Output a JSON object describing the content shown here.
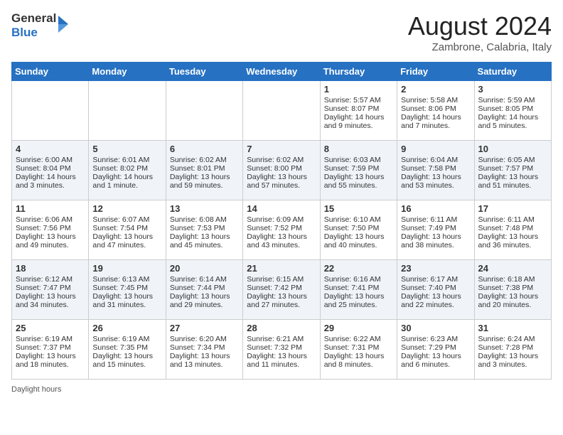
{
  "header": {
    "logo_line1": "General",
    "logo_line2": "Blue",
    "month_year": "August 2024",
    "location": "Zambrone, Calabria, Italy"
  },
  "days_of_week": [
    "Sunday",
    "Monday",
    "Tuesday",
    "Wednesday",
    "Thursday",
    "Friday",
    "Saturday"
  ],
  "weeks": [
    [
      {
        "day": "",
        "info": ""
      },
      {
        "day": "",
        "info": ""
      },
      {
        "day": "",
        "info": ""
      },
      {
        "day": "",
        "info": ""
      },
      {
        "day": "1",
        "info": "Sunrise: 5:57 AM\nSunset: 8:07 PM\nDaylight: 14 hours and 9 minutes."
      },
      {
        "day": "2",
        "info": "Sunrise: 5:58 AM\nSunset: 8:06 PM\nDaylight: 14 hours and 7 minutes."
      },
      {
        "day": "3",
        "info": "Sunrise: 5:59 AM\nSunset: 8:05 PM\nDaylight: 14 hours and 5 minutes."
      }
    ],
    [
      {
        "day": "4",
        "info": "Sunrise: 6:00 AM\nSunset: 8:04 PM\nDaylight: 14 hours and 3 minutes."
      },
      {
        "day": "5",
        "info": "Sunrise: 6:01 AM\nSunset: 8:02 PM\nDaylight: 14 hours and 1 minute."
      },
      {
        "day": "6",
        "info": "Sunrise: 6:02 AM\nSunset: 8:01 PM\nDaylight: 13 hours and 59 minutes."
      },
      {
        "day": "7",
        "info": "Sunrise: 6:02 AM\nSunset: 8:00 PM\nDaylight: 13 hours and 57 minutes."
      },
      {
        "day": "8",
        "info": "Sunrise: 6:03 AM\nSunset: 7:59 PM\nDaylight: 13 hours and 55 minutes."
      },
      {
        "day": "9",
        "info": "Sunrise: 6:04 AM\nSunset: 7:58 PM\nDaylight: 13 hours and 53 minutes."
      },
      {
        "day": "10",
        "info": "Sunrise: 6:05 AM\nSunset: 7:57 PM\nDaylight: 13 hours and 51 minutes."
      }
    ],
    [
      {
        "day": "11",
        "info": "Sunrise: 6:06 AM\nSunset: 7:56 PM\nDaylight: 13 hours and 49 minutes."
      },
      {
        "day": "12",
        "info": "Sunrise: 6:07 AM\nSunset: 7:54 PM\nDaylight: 13 hours and 47 minutes."
      },
      {
        "day": "13",
        "info": "Sunrise: 6:08 AM\nSunset: 7:53 PM\nDaylight: 13 hours and 45 minutes."
      },
      {
        "day": "14",
        "info": "Sunrise: 6:09 AM\nSunset: 7:52 PM\nDaylight: 13 hours and 43 minutes."
      },
      {
        "day": "15",
        "info": "Sunrise: 6:10 AM\nSunset: 7:50 PM\nDaylight: 13 hours and 40 minutes."
      },
      {
        "day": "16",
        "info": "Sunrise: 6:11 AM\nSunset: 7:49 PM\nDaylight: 13 hours and 38 minutes."
      },
      {
        "day": "17",
        "info": "Sunrise: 6:11 AM\nSunset: 7:48 PM\nDaylight: 13 hours and 36 minutes."
      }
    ],
    [
      {
        "day": "18",
        "info": "Sunrise: 6:12 AM\nSunset: 7:47 PM\nDaylight: 13 hours and 34 minutes."
      },
      {
        "day": "19",
        "info": "Sunrise: 6:13 AM\nSunset: 7:45 PM\nDaylight: 13 hours and 31 minutes."
      },
      {
        "day": "20",
        "info": "Sunrise: 6:14 AM\nSunset: 7:44 PM\nDaylight: 13 hours and 29 minutes."
      },
      {
        "day": "21",
        "info": "Sunrise: 6:15 AM\nSunset: 7:42 PM\nDaylight: 13 hours and 27 minutes."
      },
      {
        "day": "22",
        "info": "Sunrise: 6:16 AM\nSunset: 7:41 PM\nDaylight: 13 hours and 25 minutes."
      },
      {
        "day": "23",
        "info": "Sunrise: 6:17 AM\nSunset: 7:40 PM\nDaylight: 13 hours and 22 minutes."
      },
      {
        "day": "24",
        "info": "Sunrise: 6:18 AM\nSunset: 7:38 PM\nDaylight: 13 hours and 20 minutes."
      }
    ],
    [
      {
        "day": "25",
        "info": "Sunrise: 6:19 AM\nSunset: 7:37 PM\nDaylight: 13 hours and 18 minutes."
      },
      {
        "day": "26",
        "info": "Sunrise: 6:19 AM\nSunset: 7:35 PM\nDaylight: 13 hours and 15 minutes."
      },
      {
        "day": "27",
        "info": "Sunrise: 6:20 AM\nSunset: 7:34 PM\nDaylight: 13 hours and 13 minutes."
      },
      {
        "day": "28",
        "info": "Sunrise: 6:21 AM\nSunset: 7:32 PM\nDaylight: 13 hours and 11 minutes."
      },
      {
        "day": "29",
        "info": "Sunrise: 6:22 AM\nSunset: 7:31 PM\nDaylight: 13 hours and 8 minutes."
      },
      {
        "day": "30",
        "info": "Sunrise: 6:23 AM\nSunset: 7:29 PM\nDaylight: 13 hours and 6 minutes."
      },
      {
        "day": "31",
        "info": "Sunrise: 6:24 AM\nSunset: 7:28 PM\nDaylight: 13 hours and 3 minutes."
      }
    ]
  ],
  "footer": "Daylight hours"
}
